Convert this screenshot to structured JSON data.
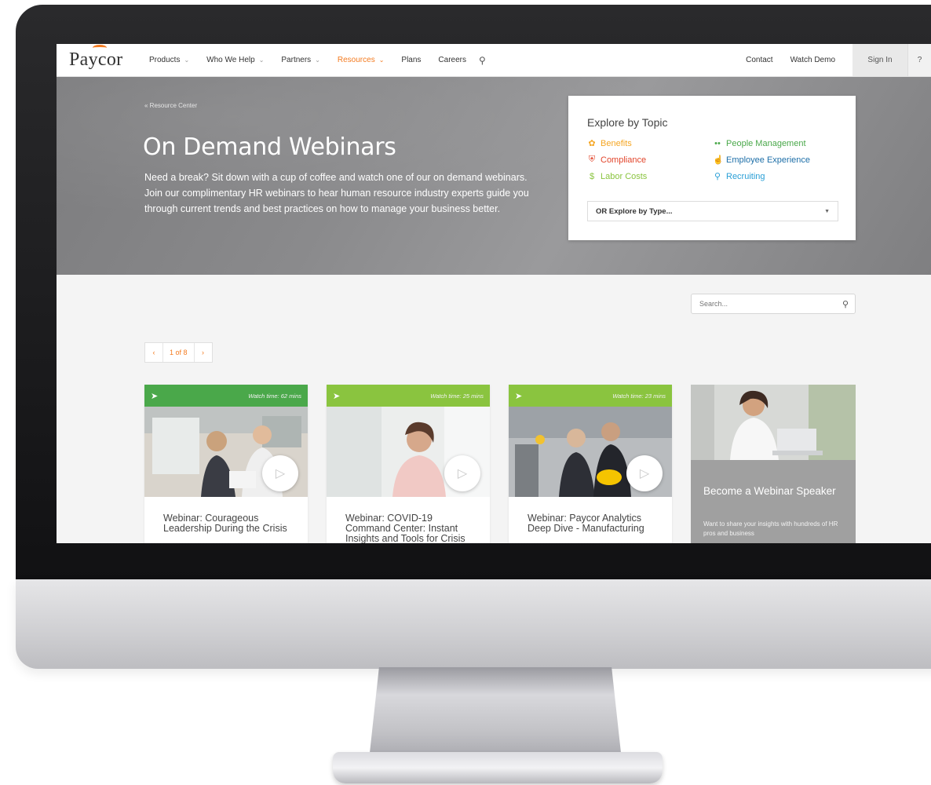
{
  "nav": {
    "logo": "Paycor",
    "items": [
      {
        "label": "Products",
        "dropdown": true,
        "active": false
      },
      {
        "label": "Who We Help",
        "dropdown": true,
        "active": false
      },
      {
        "label": "Partners",
        "dropdown": true,
        "active": false
      },
      {
        "label": "Resources",
        "dropdown": true,
        "active": true
      },
      {
        "label": "Plans",
        "dropdown": false,
        "active": false
      },
      {
        "label": "Careers",
        "dropdown": false,
        "active": false
      }
    ],
    "right": {
      "contact": "Contact",
      "watch_demo": "Watch Demo",
      "sign_in": "Sign In",
      "help": "?"
    },
    "accent_color": "#f47b20"
  },
  "hero": {
    "breadcrumb": "« Resource Center",
    "title": "On Demand Webinars",
    "description": "Need a break? Sit down with a cup of coffee and watch one of our on demand webinars. Join our complimentary HR webinars to hear human resource industry experts guide you through current trends and best practices on how to manage your business better."
  },
  "topics": {
    "heading": "Explore by Topic",
    "items": [
      {
        "label": "Benefits",
        "icon": "benefits-icon",
        "color": "#f5a623"
      },
      {
        "label": "People Management",
        "icon": "people-management-icon",
        "color": "#4aa84a"
      },
      {
        "label": "Compliance",
        "icon": "shield-icon",
        "color": "#e2452b"
      },
      {
        "label": "Employee Experience",
        "icon": "thumbs-up-icon",
        "color": "#1e6fa8"
      },
      {
        "label": "Labor Costs",
        "icon": "dollar-icon",
        "color": "#8ac43f"
      },
      {
        "label": "Recruiting",
        "icon": "magnifier-icon",
        "color": "#2a9fd6"
      }
    ],
    "type_select": "OR Explore by Type..."
  },
  "search": {
    "placeholder": "Search..."
  },
  "pager": {
    "prev": "‹",
    "count": "1 of 8",
    "next": "›"
  },
  "cards": [
    {
      "watch_time": "Watch time: 62 mins",
      "title": "Webinar: Courageous Leadership During the Crisis",
      "bar": "#4aa84a"
    },
    {
      "watch_time": "Watch time: 25 mins",
      "title": "Webinar: COVID-19 Command Center: Instant Insights and Tools for Crisis",
      "bar": "#8ac43f"
    },
    {
      "watch_time": "Watch time: 23 mins",
      "title": "Webinar: Paycor Analytics Deep Dive - Manufacturing",
      "bar": "#8ac43f"
    }
  ],
  "speaker": {
    "title": "Become a Webinar Speaker",
    "desc": "Want to share your insights with hundreds of HR pros and business"
  }
}
